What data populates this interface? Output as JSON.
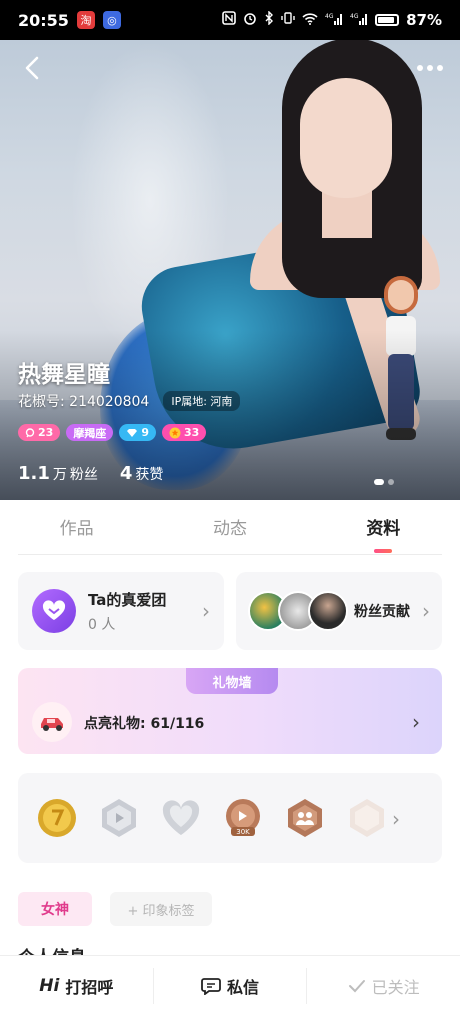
{
  "status_bar": {
    "time": "20:55",
    "network_label": "4G",
    "battery": "87%"
  },
  "profile": {
    "nickname": "热舞星瞳",
    "id_line": "花椒号: 214020804",
    "ip_location": "IP属地: 河南",
    "badges": [
      {
        "icon": "chat-bubble-icon",
        "value": "23",
        "color": "#ff6aa8"
      },
      {
        "icon": "zodiac",
        "value": "摩羯座",
        "color": "#c86bf5"
      },
      {
        "icon": "diamond-icon",
        "value": "9",
        "color": "#36b8f4"
      },
      {
        "icon": "star-icon",
        "value": "33",
        "color": "#ff4fae"
      }
    ],
    "stats": [
      {
        "num": "1.1",
        "unit": "万",
        "label": "粉丝"
      },
      {
        "num": "4",
        "unit": "",
        "label": "获赞"
      }
    ]
  },
  "tabs": [
    {
      "label": "作品",
      "active": false
    },
    {
      "label": "动态",
      "active": false
    },
    {
      "label": "资料",
      "active": true
    }
  ],
  "fan_club": {
    "title": "Ta的真爱团",
    "count": "0 人"
  },
  "fan_contribution": {
    "label": "粉丝贡献"
  },
  "gift_wall": {
    "ribbon": "礼物墙",
    "lit_label": "点亮礼物: 61/116"
  },
  "medals": {
    "items": [
      "gold-medal",
      "silver-hexagon-medal",
      "silver-heart-medal",
      "bronze-badge-medal",
      "bronze-hexagon-medal",
      "faded-hexagon-medal"
    ],
    "medal_label_30k": "30K"
  },
  "tags": {
    "goddess": "女神",
    "add": "+ 印象标签"
  },
  "section_heading_partial": "个人信息",
  "bottom_bar": {
    "greet_hi": "Hi",
    "greet": "打招呼",
    "message": "私信",
    "followed": "已关注"
  },
  "colors": {
    "accent": "#ff4f86",
    "purple": "#8a48f0"
  }
}
